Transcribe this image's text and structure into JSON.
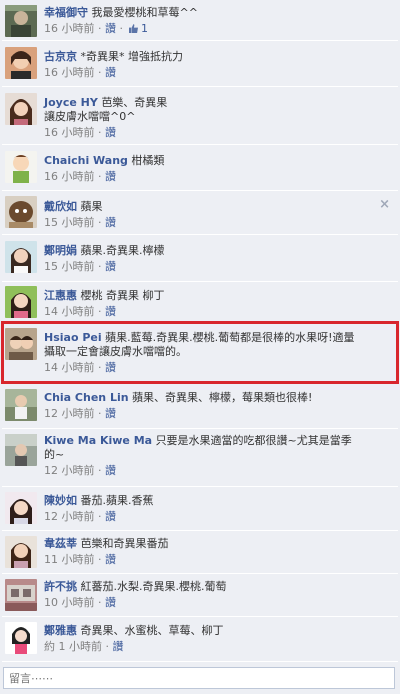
{
  "comments": [
    {
      "name": "幸福御守",
      "text": "我最愛櫻桃和草莓^^",
      "time": "16 小時前",
      "like": "讚",
      "likes": "1",
      "avatar": "a0"
    },
    {
      "name": "古京京",
      "text": "*奇異果* 增強抵抗力",
      "time": "16 小時前",
      "like": "讚",
      "avatar": "a1"
    },
    {
      "name": "Joyce HY",
      "text": "芭樂、奇異果",
      "text2": "讓皮膚水噹噹^0^",
      "time": "16 小時前",
      "like": "讚",
      "avatar": "a2"
    },
    {
      "name": "Chaichi Wang",
      "text": "柑橘類",
      "time": "16 小時前",
      "like": "讚",
      "avatar": "a3"
    },
    {
      "name": "戴欣如",
      "text": "蘋果",
      "time": "15 小時前",
      "like": "讚",
      "avatar": "a4",
      "close": "×"
    },
    {
      "name": "鄭明娟",
      "text": "蘋果.奇異果.檸檬",
      "time": "15 小時前",
      "like": "讚",
      "avatar": "a5"
    },
    {
      "name": "江惠惠",
      "text": "櫻桃 奇異果 柳丁",
      "time": "14 小時前",
      "like": "讚",
      "avatar": "a6"
    },
    {
      "name": "Hsiao Pei",
      "text": "蘋果.藍莓.奇異果.櫻桃.葡萄都是很棒的水果呀!適量",
      "text2": "攝取一定會讓皮膚水噹噹的。",
      "time": "14 小時前",
      "like": "讚",
      "avatar": "a7"
    },
    {
      "name": "Chia Chen Lin",
      "text": "蘋果、奇異果、檸檬，莓果類也很棒!",
      "time": "12 小時前",
      "like": "讚",
      "avatar": "a8"
    },
    {
      "name": "Kiwe Ma Kiwe Ma",
      "text": "只要是水果適當的吃都很讚~尤其是當季",
      "text2": "的~",
      "time": "12 小時前",
      "like": "讚",
      "avatar": "a9"
    },
    {
      "name": "陳妙如",
      "text": "番茄.蘋果.香蕉",
      "time": "12 小時前",
      "like": "讚",
      "avatar": "a10"
    },
    {
      "name": "韋茲莘",
      "text": "芭樂和奇異果番茄",
      "time": "11 小時前",
      "like": "讚",
      "avatar": "a11"
    },
    {
      "name": "許不挑",
      "text": "紅蕃茄.水梨.奇異果.櫻桃.葡萄",
      "time": "10 小時前",
      "like": "讚",
      "avatar": "a12"
    },
    {
      "name": "鄭雅惠",
      "text": "奇異果、水蜜桃、草莓、柳丁",
      "time": "約 1 小時前",
      "like": "讚",
      "avatar": "a13"
    }
  ],
  "separator": "·",
  "comment_input": {
    "placeholder": "留言⋯⋯"
  }
}
